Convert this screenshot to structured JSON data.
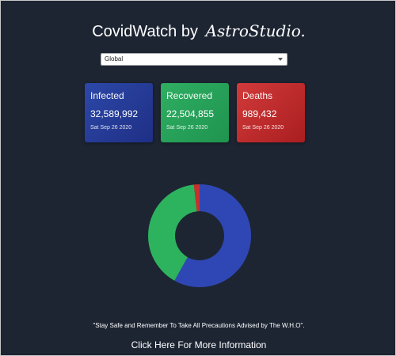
{
  "header": {
    "title": "CovidWatch by",
    "brand": "AstroStudio."
  },
  "region_select": {
    "selected": "Global"
  },
  "cards": {
    "infected": {
      "title": "Infected",
      "value": "32,589,992",
      "date": "Sat Sep 26 2020",
      "color": "#2a45a3"
    },
    "recovered": {
      "title": "Recovered",
      "value": "22,504,855",
      "date": "Sat Sep 26 2020",
      "color": "#27a35a"
    },
    "deaths": {
      "title": "Deaths",
      "value": "989,432",
      "date": "Sat Sep 26 2020",
      "color": "#c42b2d"
    }
  },
  "chart_data": {
    "type": "pie",
    "donut": true,
    "categories": [
      "Infected",
      "Recovered",
      "Deaths"
    ],
    "values": [
      32589992,
      22504855,
      989432
    ],
    "colors": [
      "#2f47b4",
      "#2db35e",
      "#c9302c"
    ],
    "start": "top",
    "legend": "none"
  },
  "footer": {
    "quote": "\"Stay Safe and Remember To Take All Precautions Advised by The W.H.O\".",
    "link": "Click Here For More Information"
  }
}
